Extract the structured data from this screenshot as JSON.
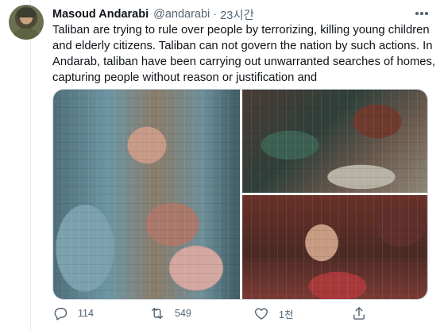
{
  "author": {
    "name": "Masoud Andarabi",
    "handle": "@andarabi",
    "separator": "·",
    "time": "23시간"
  },
  "tweet": {
    "lines": [
      "Taliban are trying to rule over people by terrorizing, killing young children",
      "and elderly citizens. Taliban can not govern the nation by such actions. In",
      "Andarab, taliban have been carrying out unwarranted searches of homes,",
      "capturing people without reason or justification and"
    ]
  },
  "media": {
    "images": [
      "blurred-photo",
      "blurred-photo",
      "blurred-photo"
    ]
  },
  "actions": {
    "reply_count": "114",
    "retweet_count": "549",
    "like_count": "1천",
    "share_count": ""
  },
  "colors": {
    "text": "#0f1419",
    "secondary": "#536471",
    "border": "#cfd9de"
  },
  "icons": [
    "more-icon",
    "reply-icon",
    "retweet-icon",
    "like-icon",
    "share-icon"
  ]
}
